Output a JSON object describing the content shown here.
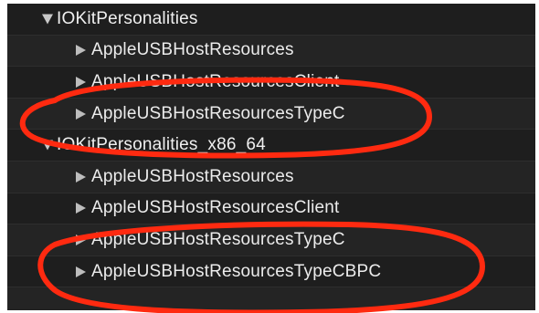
{
  "tree": {
    "rows": [
      {
        "label": "IOKitPersonalities",
        "type": "group",
        "expanded": true
      },
      {
        "label": "AppleUSBHostResources",
        "type": "item",
        "expanded": false
      },
      {
        "label": "AppleUSBHostResourcesClient",
        "type": "item",
        "expanded": false
      },
      {
        "label": "AppleUSBHostResourcesTypeC",
        "type": "item",
        "expanded": false
      },
      {
        "label": "IOKitPersonalities_x86_64",
        "type": "group",
        "expanded": true
      },
      {
        "label": "AppleUSBHostResources",
        "type": "item",
        "expanded": false
      },
      {
        "label": "AppleUSBHostResourcesClient",
        "type": "item",
        "expanded": false
      },
      {
        "label": "AppleUSBHostResourcesTypeC",
        "type": "item",
        "expanded": false
      },
      {
        "label": "AppleUSBHostResourcesTypeCBPC",
        "type": "item",
        "expanded": false
      }
    ]
  },
  "colors": {
    "background": "#1e1e1e",
    "text": "#ececec",
    "annotation": "#ff2a10"
  }
}
